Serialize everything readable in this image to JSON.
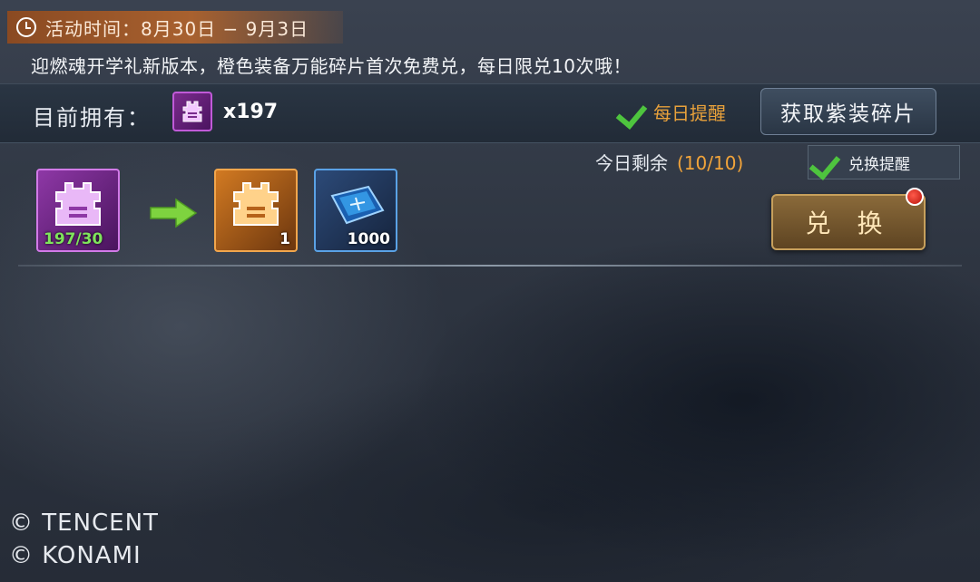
{
  "event": {
    "time_label": "活动时间：8月30日 − 9月3日",
    "notice": "迎燃魂开学礼新版本，橙色装备万能碎片首次免费兑，每日限兑10次哦！"
  },
  "owned": {
    "label": "目前拥有：",
    "count": "x197",
    "daily_remind_label": "每日提醒",
    "get_button_label": "获取紫装碎片"
  },
  "exchange_row": {
    "remain_label": "今日剩余",
    "remain_count": "(10/10)",
    "exchange_remind_label": "兑换提醒",
    "cost_item": {
      "icon": "purple-armor-piece-icon",
      "progress": "197/30"
    },
    "reward_items": [
      {
        "icon": "orange-armor-piece-icon",
        "count": "1"
      },
      {
        "icon": "chip-icon",
        "count": "1000"
      }
    ],
    "exchange_button_label": "兑 换"
  },
  "copyright": {
    "line1": "© TENCENT",
    "line2": "©  KONAMI"
  },
  "colors": {
    "accent_orange": "#e8a13b",
    "check_green": "#4ec43e",
    "progress_green": "#7fe35c",
    "purple_border": "#d27ae8",
    "orange_border": "#f2a64c",
    "blue_border": "#5aa2e6"
  }
}
